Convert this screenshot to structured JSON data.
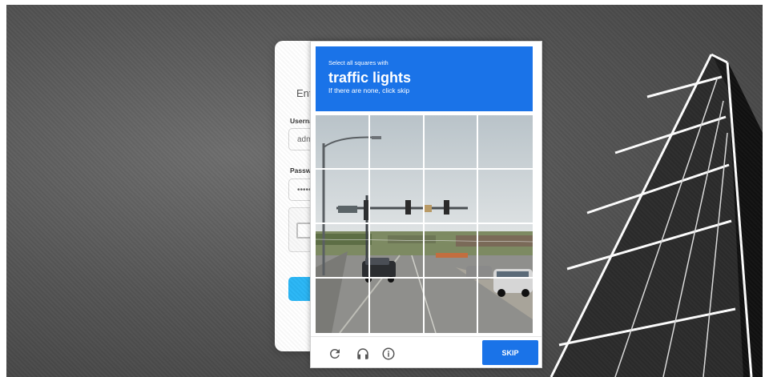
{
  "login": {
    "heading": "Ente",
    "username_label": "Usernam",
    "username_value": "admin",
    "password_label": "Passwor",
    "password_value": "•••••"
  },
  "challenge": {
    "prompt": "Select all squares with",
    "target": "traffic lights",
    "instruction": "If there are none, click skip",
    "skip_label": "SKIP",
    "icons": [
      "reload-icon",
      "headphones-icon",
      "info-icon"
    ],
    "grid_rows": 4,
    "grid_cols": 4,
    "header_color": "#1a73e8"
  },
  "colors": {
    "login_button": "#29b6f6",
    "accent": "#1a73e8"
  }
}
